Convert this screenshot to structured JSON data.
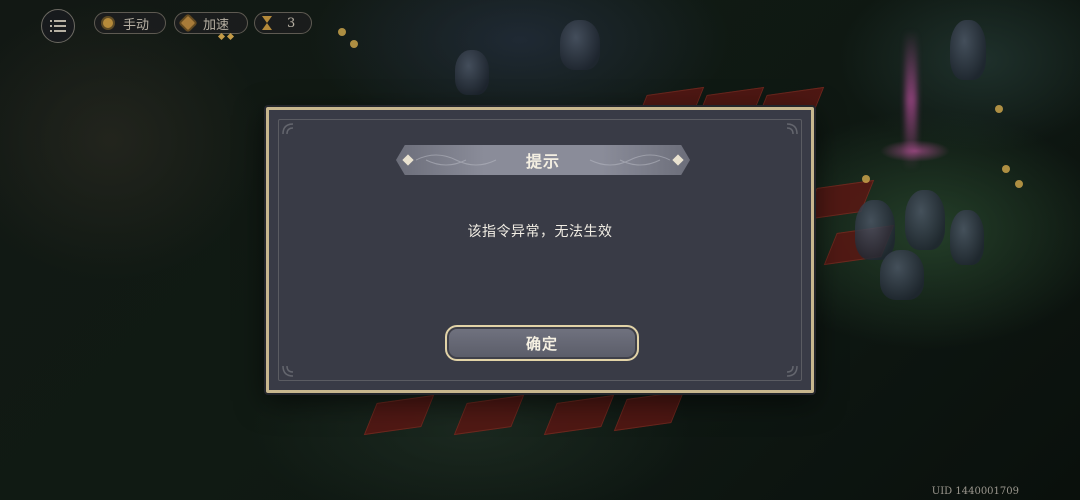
{
  "hud": {
    "mode_label": "手动",
    "speed_label": "加速",
    "turn_count": "3",
    "icons": [
      "menu-icon",
      "auto-mode-icon",
      "speed-gear-icon",
      "hourglass-icon"
    ]
  },
  "dialog": {
    "title": "提示",
    "message": "该指令异常，无法生效",
    "confirm_label": "确定"
  },
  "footer": {
    "uid": "UID 1440001709"
  },
  "colors": {
    "dialog_bg": "#393b46",
    "dialog_border": "#c8b78e",
    "ribbon": "#8a8c99",
    "button_border": "#e2d3a7"
  }
}
